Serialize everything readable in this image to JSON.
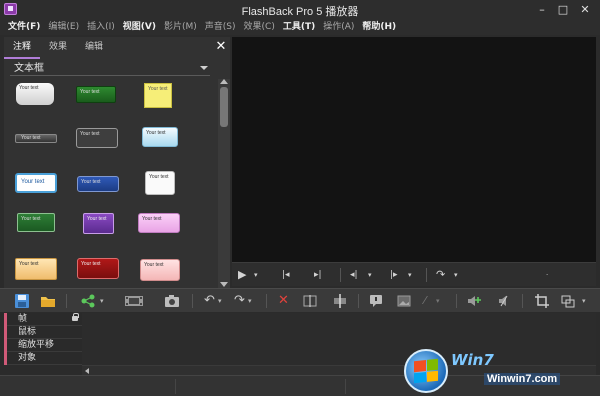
{
  "window": {
    "title": "FlashBack Pro 5 播放器",
    "min": "–",
    "max": "□",
    "close": "✕"
  },
  "menu": [
    {
      "label": "文件(F)",
      "bold": true
    },
    {
      "label": "编辑(E)",
      "bold": false
    },
    {
      "label": "插入(I)",
      "bold": false
    },
    {
      "label": "视图(V)",
      "bold": true
    },
    {
      "label": "影片(M)",
      "bold": false
    },
    {
      "label": "声音(S)",
      "bold": false
    },
    {
      "label": "效果(C)",
      "bold": false
    },
    {
      "label": "工具(T)",
      "bold": true
    },
    {
      "label": "操作(A)",
      "bold": false
    },
    {
      "label": "帮助(H)",
      "bold": true
    }
  ],
  "left_panel": {
    "tabs": [
      "注释",
      "效果",
      "编辑"
    ],
    "active_tab": 0,
    "dropdown": "文本框",
    "callout_text": "Your text"
  },
  "tracks": [
    "帧",
    "鼠标",
    "缩放平移",
    "对象"
  ],
  "watermark": {
    "logo_text": "Win7",
    "url": "Winwin7.com"
  },
  "colors": {
    "accent": "#b07dd8",
    "track_marker": "#d05a78",
    "video_bg": "#131313"
  }
}
